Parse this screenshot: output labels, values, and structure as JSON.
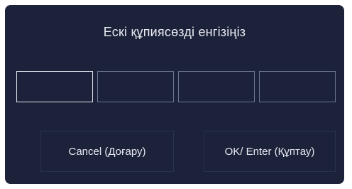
{
  "dialog": {
    "title": "Ескі құпиясөзді енгізіңіз",
    "pin_fields": [
      {
        "value": "",
        "active": true
      },
      {
        "value": "",
        "active": false
      },
      {
        "value": "",
        "active": false
      },
      {
        "value": "",
        "active": false
      }
    ],
    "buttons": {
      "cancel_label": "Cancel (Доғару)",
      "ok_label": "OK/ Enter (Құптау)"
    }
  },
  "colors": {
    "background": "#1c2239",
    "text": "#e8eaf2",
    "active_border": "#dfe3ee",
    "inactive_border": "#6c7590"
  }
}
